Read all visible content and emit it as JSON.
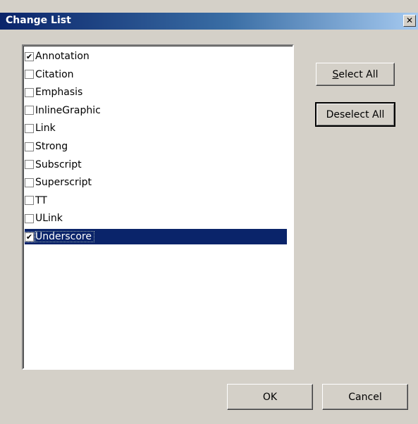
{
  "window": {
    "title": "Change List",
    "close_glyph": "✕"
  },
  "list": {
    "items": [
      {
        "label": "Annotation",
        "checked": true,
        "selected": false
      },
      {
        "label": "Citation",
        "checked": false,
        "selected": false
      },
      {
        "label": "Emphasis",
        "checked": false,
        "selected": false
      },
      {
        "label": "InlineGraphic",
        "checked": false,
        "selected": false
      },
      {
        "label": "Link",
        "checked": false,
        "selected": false
      },
      {
        "label": "Strong",
        "checked": false,
        "selected": false
      },
      {
        "label": "Subscript",
        "checked": false,
        "selected": false
      },
      {
        "label": "Superscript",
        "checked": false,
        "selected": false
      },
      {
        "label": "TT",
        "checked": false,
        "selected": false
      },
      {
        "label": "ULink",
        "checked": false,
        "selected": false
      },
      {
        "label": "Underscore",
        "checked": true,
        "selected": true
      }
    ],
    "check_glyph": "✔"
  },
  "buttons": {
    "select_all_mnemonic": "S",
    "select_all_rest": "elect All",
    "deselect_all": "Deselect All",
    "ok": "OK",
    "cancel": "Cancel"
  },
  "colors": {
    "titlebar_start": "#0a246a",
    "selection": "#0a246a",
    "face": "#d4d0c8"
  }
}
